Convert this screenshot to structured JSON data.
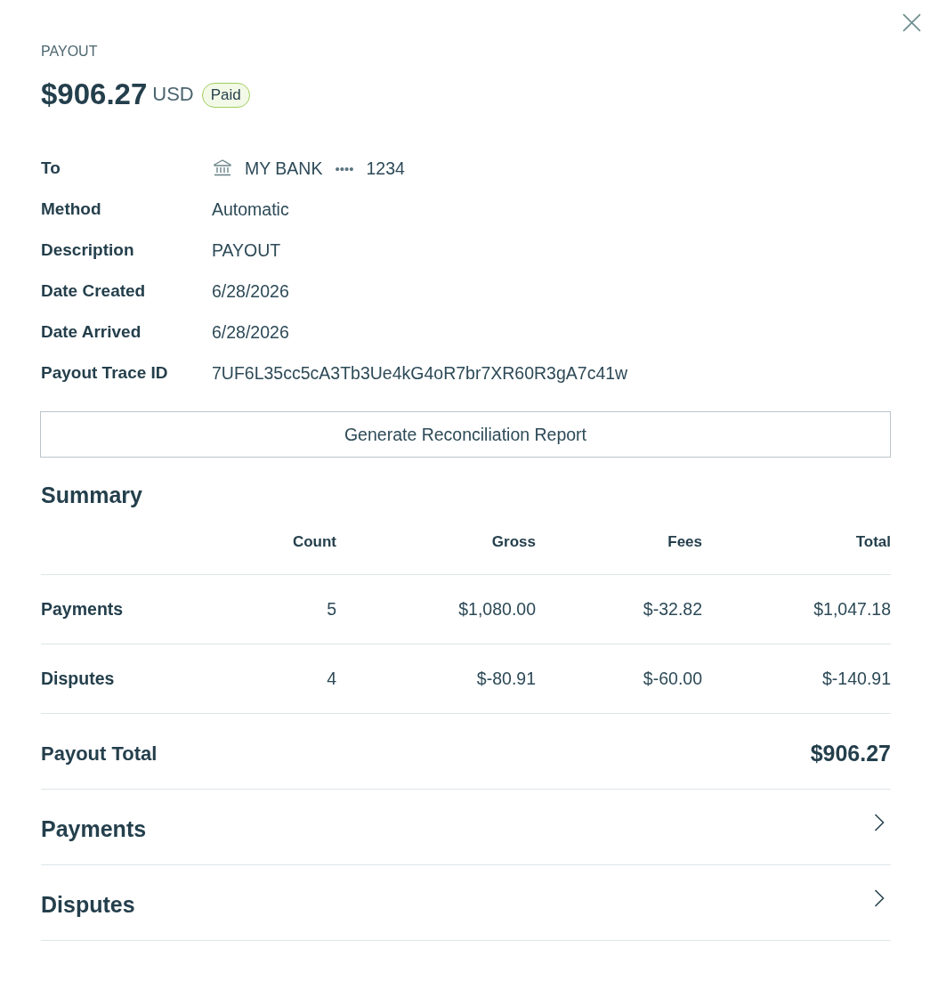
{
  "header": {
    "eyebrow": "PAYOUT",
    "amount": "$906.27",
    "currency": "USD",
    "status": {
      "label": "Paid",
      "kind": "paid"
    }
  },
  "details": [
    {
      "label": "To",
      "kind": "bank",
      "bank": "MY BANK",
      "mask": "••••",
      "last4": "1234"
    },
    {
      "label": "Method",
      "kind": "text",
      "value": "Automatic"
    },
    {
      "label": "Description",
      "kind": "text",
      "value": "PAYOUT"
    },
    {
      "label": "Date Created",
      "kind": "text",
      "value": "6/28/2026"
    },
    {
      "label": "Date Arrived",
      "kind": "text",
      "value": "6/28/2026"
    },
    {
      "label": "Payout Trace ID",
      "kind": "text",
      "value": "7UF6L35cc5cA3Tb3Ue4kG4oR7br7XR60R3gA7c41w"
    }
  ],
  "report_button": "Generate Reconciliation Report",
  "summary": {
    "title": "Summary",
    "columns": [
      "Count",
      "Gross",
      "Fees",
      "Total"
    ],
    "rows": [
      {
        "label": "Payments",
        "cells": [
          "5",
          "$1,080.00",
          "$-32.82",
          "$1,047.18"
        ]
      },
      {
        "label": "Disputes",
        "cells": [
          "4",
          "$-80.91",
          "$-60.00",
          "$-140.91"
        ]
      }
    ],
    "total": {
      "label": "Payout Total",
      "value": "$906.27"
    }
  },
  "sections": [
    {
      "title": "Payments",
      "expanded": false
    },
    {
      "title": "Disputes",
      "expanded": false
    }
  ]
}
